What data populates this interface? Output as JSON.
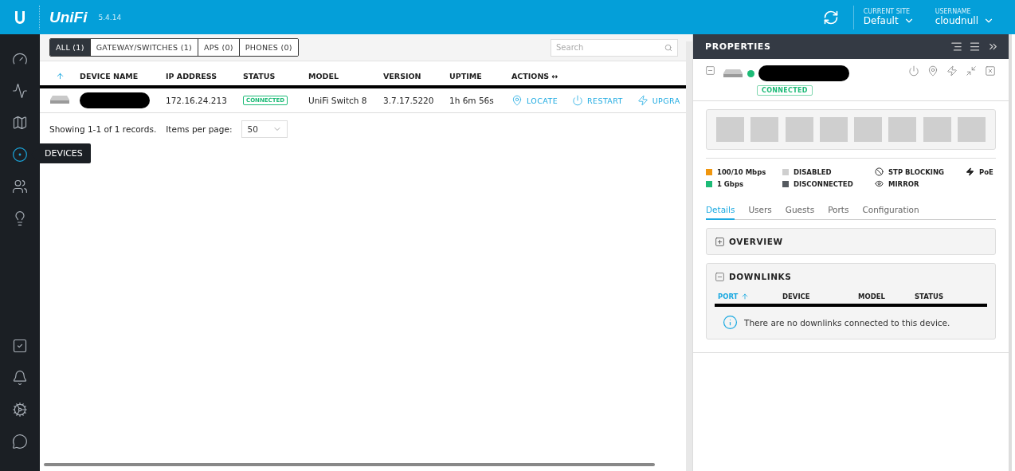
{
  "header": {
    "logo": "UniFi",
    "version": "5.4.14",
    "site_label": "CURRENT SITE",
    "site": "Default",
    "user_label": "USERNAME",
    "user": "cloudnull"
  },
  "sidebar": {
    "top": [
      {
        "selected": false
      },
      {
        "selected": false
      },
      {
        "selected": false
      },
      {
        "selected": true
      },
      {
        "selected": false
      },
      {
        "selected": false
      }
    ],
    "bottom": [
      {
        "selected": false
      },
      {
        "selected": false
      },
      {
        "selected": false
      },
      {
        "selected": false
      }
    ],
    "tooltip": "DEVICES"
  },
  "filters": [
    {
      "label": "ALL (1)",
      "selected": true
    },
    {
      "label": "GATEWAY/SWITCHES (1)",
      "selected": false
    },
    {
      "label": "APS (0)",
      "selected": false
    },
    {
      "label": "PHONES (0)",
      "selected": false
    }
  ],
  "search": {
    "placeholder": "Search"
  },
  "table": {
    "columns": [
      "DEVICE NAME",
      "IP ADDRESS",
      "STATUS",
      "MODEL",
      "VERSION",
      "UPTIME",
      "ACTIONS ↔"
    ],
    "rows": [
      {
        "ip": "172.16.24.213",
        "status": "CONNECTED",
        "model": "UniFi Switch 8",
        "version": "3.7.17.5220",
        "uptime": "1h 6m 56s",
        "actions": [
          "LOCATE",
          "RESTART",
          "UPGRA"
        ]
      }
    ]
  },
  "pagination": {
    "summary": "Showing 1-1 of 1 records.",
    "per_page_label": "Items per page:",
    "per_page": "50"
  },
  "properties": {
    "title": "PROPERTIES",
    "status": "CONNECTED",
    "ports": [
      {
        "color": "#cfcfcf"
      },
      {
        "color": "#cfcfcf"
      },
      {
        "color": "#cfcfcf"
      },
      {
        "color": "#cfcfcf"
      },
      {
        "color": "#cfcfcf"
      },
      {
        "color": "#cfcfcf"
      },
      {
        "color": "#cfcfcf"
      },
      {
        "color": "#cfcfcf"
      }
    ],
    "legend": [
      {
        "kind": "swatch",
        "label": "100/10 Mbps",
        "color": "#f0960e"
      },
      {
        "kind": "swatch",
        "label": "1 Gbps",
        "color": "#1dbb77"
      },
      {
        "kind": "swatch",
        "label": "DISABLED",
        "color": "#cfcfcf"
      },
      {
        "kind": "swatch",
        "label": "DISCONNECTED",
        "color": "#555a60"
      },
      {
        "kind": "blocked",
        "label": "STP BLOCKING"
      },
      {
        "kind": "mirror",
        "label": "MIRROR"
      },
      {
        "kind": "poe",
        "label": "PoE"
      }
    ],
    "tabs": [
      {
        "label": "Details",
        "selected": true
      },
      {
        "label": "Users",
        "selected": false
      },
      {
        "label": "Guests",
        "selected": false
      },
      {
        "label": "Ports",
        "selected": false
      },
      {
        "label": "Configuration",
        "selected": false
      }
    ],
    "sections": [
      {
        "title": "OVERVIEW",
        "expanded": false
      },
      {
        "title": "DOWNLINKS",
        "expanded": true,
        "columns": [
          {
            "label": "PORT",
            "sorted": true
          },
          {
            "label": "DEVICE",
            "sorted": false
          },
          {
            "label": "MODEL",
            "sorted": false
          },
          {
            "label": "STATUS",
            "sorted": false
          }
        ],
        "empty": "There are no downlinks connected to this device."
      }
    ]
  }
}
